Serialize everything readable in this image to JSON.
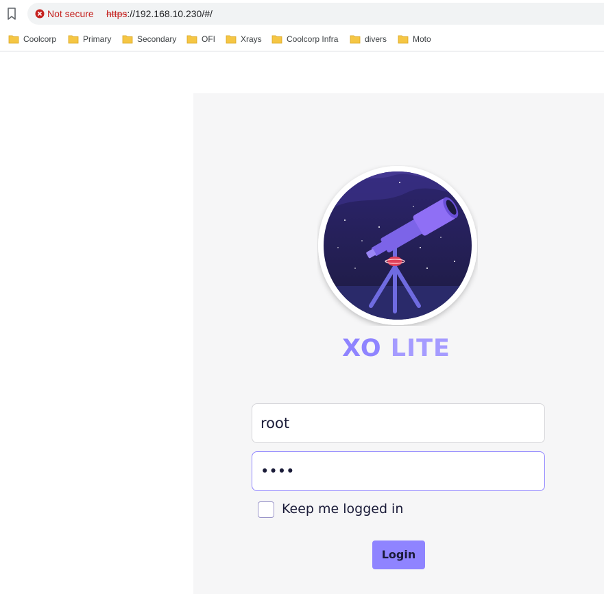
{
  "browser": {
    "security_label": "Not secure",
    "url_scheme": "https",
    "url_rest": "://192.168.10.230/#/"
  },
  "bookmarks": [
    {
      "label": "Coolcorp"
    },
    {
      "label": "Primary"
    },
    {
      "label": "Secondary"
    },
    {
      "label": "OFI"
    },
    {
      "label": "Xrays"
    },
    {
      "label": "Coolcorp Infra"
    },
    {
      "label": "divers"
    },
    {
      "label": "Moto"
    }
  ],
  "login": {
    "brand_first": "XO",
    "brand_second": " LITE",
    "username_value": "root",
    "password_value": "••••",
    "keep_logged_in_label": "Keep me logged in",
    "keep_logged_in_checked": false,
    "login_button": "Login"
  },
  "colors": {
    "accent": "#8f84ff",
    "panel_bg": "#f6f6f7",
    "not_secure": "#c5221f"
  }
}
